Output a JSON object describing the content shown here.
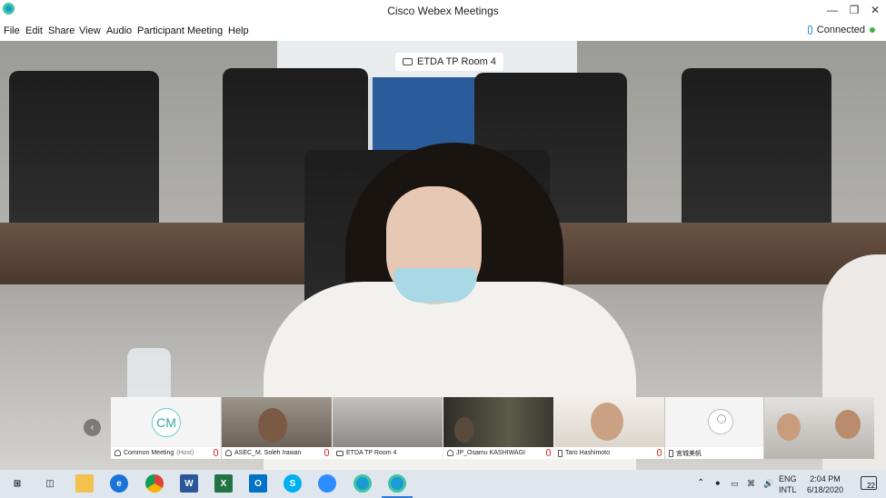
{
  "window": {
    "title": "Cisco Webex Meetings"
  },
  "menu": {
    "items": [
      {
        "label": "File"
      },
      {
        "label": "Edit"
      },
      {
        "label": "Share"
      },
      {
        "label": "View"
      },
      {
        "label": "Audio"
      },
      {
        "label": "Participant"
      },
      {
        "label": "Meeting"
      },
      {
        "label": "Help"
      }
    ],
    "status": "Connected",
    "status_color": "#3cb54a"
  },
  "video": {
    "room_label": "ETDA TP Room 4"
  },
  "participants": [
    {
      "name": "Common Meeting",
      "role": "(Host)",
      "initials": "CM",
      "device": "headset-icon",
      "muted": true
    },
    {
      "name": "ASEC_M. Soleh Irawan",
      "device": "headset-icon",
      "muted": true
    },
    {
      "name": "ETDA TP Room 4",
      "device": "share-icon",
      "muted": false
    },
    {
      "name": "JP_Osamu KASHIWAGI",
      "device": "headset-icon",
      "muted": true
    },
    {
      "name": "Taro Hashimoto",
      "device": "phone-icon",
      "muted": true
    },
    {
      "name": "宮城美帆",
      "device": "phone-icon",
      "muted": false
    },
    {
      "name": "",
      "device": "",
      "muted": false
    }
  ],
  "taskbar": {
    "apps": [
      "start-icon",
      "task-view-icon",
      "file-explorer-icon",
      "edge-icon",
      "chrome-icon",
      "word-icon",
      "excel-icon",
      "outlook-icon",
      "skype-icon",
      "zoom-icon",
      "webex-icon",
      "webex-meetings-icon"
    ],
    "tray": {
      "lang_top": "ENG",
      "lang_bottom": "INTL",
      "time": "2:04 PM",
      "date": "6/18/2020",
      "notifications": "22"
    }
  }
}
